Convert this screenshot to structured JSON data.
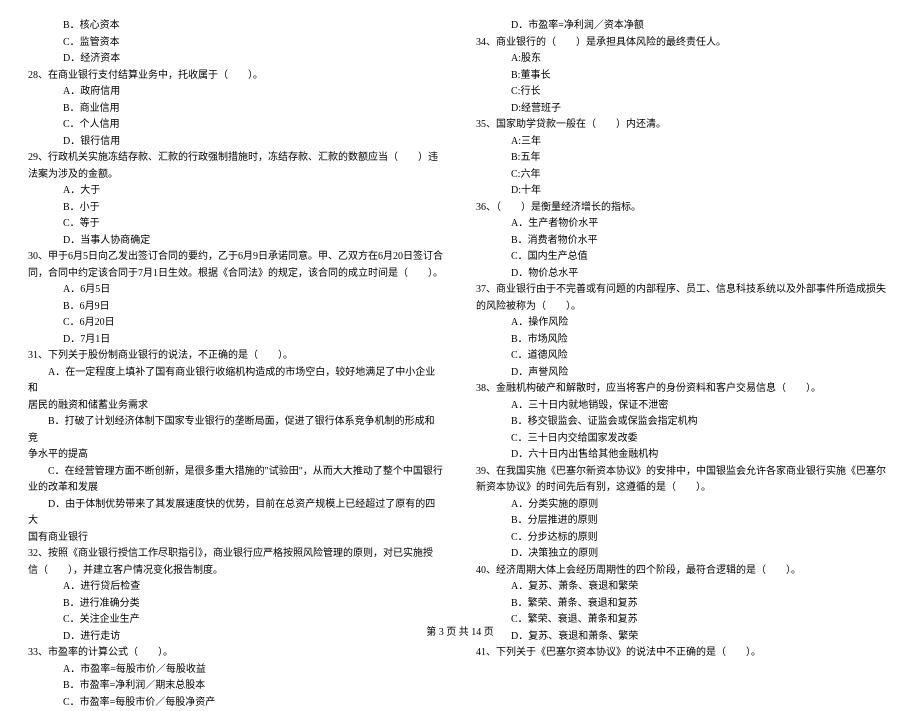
{
  "left": {
    "lines": [
      {
        "cls": "opt",
        "text": "B．核心资本"
      },
      {
        "cls": "opt",
        "text": "C．监管资本"
      },
      {
        "cls": "opt",
        "text": "D．经济资本"
      },
      {
        "cls": "q",
        "text": "28、在商业银行支付结算业务中，托收属于（　　）。"
      },
      {
        "cls": "opt",
        "text": "A．政府信用"
      },
      {
        "cls": "opt",
        "text": "B．商业信用"
      },
      {
        "cls": "opt",
        "text": "C．个人信用"
      },
      {
        "cls": "opt",
        "text": "D．银行信用"
      },
      {
        "cls": "q",
        "text": "29、行政机关实施冻结存款、汇款的行政强制措施时，冻结存款、汇款的数额应当（　　）违"
      },
      {
        "cls": "q",
        "text": "法案为涉及的金额。"
      },
      {
        "cls": "opt",
        "text": "A．大于"
      },
      {
        "cls": "opt",
        "text": "B．小于"
      },
      {
        "cls": "opt",
        "text": "C．等于"
      },
      {
        "cls": "opt",
        "text": "D．当事人协商确定"
      },
      {
        "cls": "q",
        "text": "30、甲于6月5日向乙发出签订合同的要约，乙于6月9日承诺同意。甲、乙双方在6月20日签订合"
      },
      {
        "cls": "q",
        "text": "同，合同中约定该合同于7月1日生效。根据《合同法》的规定，该合同的成立时间是（　　）。"
      },
      {
        "cls": "opt",
        "text": "A．6月5日"
      },
      {
        "cls": "opt",
        "text": "B．6月9日"
      },
      {
        "cls": "opt",
        "text": "C．6月20日"
      },
      {
        "cls": "opt",
        "text": "D．7月1日"
      },
      {
        "cls": "q",
        "text": "31、下列关于股份制商业银行的说法，不正确的是（　　）。"
      },
      {
        "cls": "para-ind",
        "text": "A．在一定程度上填补了国有商业银行收缩机构造成的市场空白，较好地满足了中小企业和"
      },
      {
        "cls": "q",
        "text": "居民的融资和储蓄业务需求"
      },
      {
        "cls": "para-ind",
        "text": "B．打破了计划经济体制下国家专业银行的垄断局面，促进了银行体系竞争机制的形成和竞"
      },
      {
        "cls": "q",
        "text": "争水平的提高"
      },
      {
        "cls": "para-ind",
        "text": "C．在经营管理方面不断创新，是很多重大措施的\"试验田\"，从而大大推动了整个中国银行"
      },
      {
        "cls": "q",
        "text": "业的改革和发展"
      },
      {
        "cls": "para-ind",
        "text": "D．由于体制优势带来了其发展速度快的优势，目前在总资产规模上已经超过了原有的四大"
      },
      {
        "cls": "q",
        "text": "国有商业银行"
      },
      {
        "cls": "q",
        "text": "32、按照《商业银行授信工作尽职指引》，商业银行应严格按照风险管理的原则，对已实施授"
      },
      {
        "cls": "q",
        "text": "信（　　），并建立客户情况变化报告制度。"
      },
      {
        "cls": "opt",
        "text": "A．进行贷后检查"
      },
      {
        "cls": "opt",
        "text": "B．进行准确分类"
      },
      {
        "cls": "opt",
        "text": "C．关注企业生产"
      },
      {
        "cls": "opt",
        "text": "D．进行走访"
      },
      {
        "cls": "q",
        "text": "33、市盈率的计算公式（　　）。"
      },
      {
        "cls": "opt",
        "text": "A．市盈率=每股市价／每股收益"
      },
      {
        "cls": "opt",
        "text": "B．市盈率=净利润／期末总股本"
      },
      {
        "cls": "opt",
        "text": "C．市盈率=每股市价／每股净资产"
      }
    ]
  },
  "right": {
    "lines": [
      {
        "cls": "opt",
        "text": "D．市盈率=净利润／资本净额"
      },
      {
        "cls": "q",
        "text": "34、商业银行的（　　）是承担具体风险的最终责任人。"
      },
      {
        "cls": "opt",
        "text": "A:股东"
      },
      {
        "cls": "opt",
        "text": "B:董事长"
      },
      {
        "cls": "opt",
        "text": "C:行长"
      },
      {
        "cls": "opt",
        "text": "D:经营班子"
      },
      {
        "cls": "q",
        "text": "35、国家助学贷款一般在（　　）内还清。"
      },
      {
        "cls": "opt",
        "text": "A:三年"
      },
      {
        "cls": "opt",
        "text": "B:五年"
      },
      {
        "cls": "opt",
        "text": "C:六年"
      },
      {
        "cls": "opt",
        "text": "D:十年"
      },
      {
        "cls": "q",
        "text": "36、（　　）是衡量经济增长的指标。"
      },
      {
        "cls": "opt",
        "text": "A．生产者物价水平"
      },
      {
        "cls": "opt",
        "text": "B．消费者物价水平"
      },
      {
        "cls": "opt",
        "text": "C．国内生产总值"
      },
      {
        "cls": "opt",
        "text": "D．物价总水平"
      },
      {
        "cls": "q",
        "text": "37、商业银行由于不完善或有问题的内部程序、员工、信息科技系统以及外部事件所造成损失"
      },
      {
        "cls": "q",
        "text": "的风险被称为（　　）。"
      },
      {
        "cls": "opt",
        "text": "A．操作风险"
      },
      {
        "cls": "opt",
        "text": "B．市场风险"
      },
      {
        "cls": "opt",
        "text": "C．道德风险"
      },
      {
        "cls": "opt",
        "text": "D．声誉风险"
      },
      {
        "cls": "q",
        "text": "38、金融机构破产和解散时，应当将客户的身份资料和客户交易信息（　　）。"
      },
      {
        "cls": "opt",
        "text": "A．三十日内就地销毁，保证不泄密"
      },
      {
        "cls": "opt",
        "text": "B．移交银监会、证监会或保监会指定机构"
      },
      {
        "cls": "opt",
        "text": "C．三十日内交给国家发改委"
      },
      {
        "cls": "opt",
        "text": "D．六十日内出售给其他金融机构"
      },
      {
        "cls": "q",
        "text": "39、在我国实施《巴塞尔新资本协议》的安排中，中国银监会允许各家商业银行实施《巴塞尔"
      },
      {
        "cls": "q",
        "text": "新资本协议》的时间先后有别，这遵循的是（　　）。"
      },
      {
        "cls": "opt",
        "text": "A．分类实施的原则"
      },
      {
        "cls": "opt",
        "text": "B．分层推进的原则"
      },
      {
        "cls": "opt",
        "text": "C．分步达标的原则"
      },
      {
        "cls": "opt",
        "text": "D．决策独立的原则"
      },
      {
        "cls": "q",
        "text": "40、经济周期大体上会经历周期性的四个阶段，最符合逻辑的是（　　）。"
      },
      {
        "cls": "opt",
        "text": "A．复苏、萧条、衰退和繁荣"
      },
      {
        "cls": "opt",
        "text": "B．繁荣、萧条、衰退和复苏"
      },
      {
        "cls": "opt",
        "text": "C．繁荣、衰退、萧条和复苏"
      },
      {
        "cls": "opt",
        "text": "D．复苏、衰退和萧条、繁荣"
      },
      {
        "cls": "q",
        "text": "41、下列关于《巴塞尔资本协议》的说法中不正确的是（　　）。"
      }
    ]
  },
  "footer": "第 3 页 共 14 页"
}
